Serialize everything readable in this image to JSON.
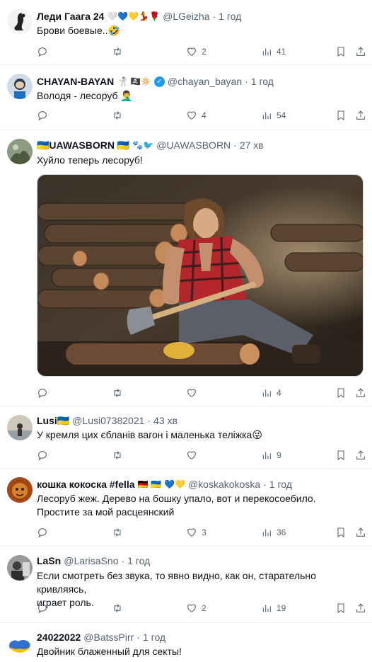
{
  "tweets": [
    {
      "name": "Леди Гаага 24",
      "name_emoji": "🤍💙💛💃🌹",
      "handle": "@LGeizha",
      "time": "1 год",
      "lines": [
        "Брови боевые..🤣"
      ],
      "likes": "2",
      "views": "41"
    },
    {
      "name": "CHAYAN-BAYAN",
      "name_emoji": "🤺 🏴‍☠️🔅",
      "handle": "@chayan_bayan",
      "time": "1 год",
      "lines": [
        "Володя - лесоруб 🤦‍♂️"
      ],
      "likes": "4",
      "views": "54"
    },
    {
      "name": "🇺🇦UAWASBORN 🇺🇦",
      "name_emoji": "🐾🐦",
      "handle": "@UAWASBORN",
      "time": "27 хв",
      "lines": [
        "Хуйло теперь лесоруб!"
      ],
      "likes": "",
      "views": "4"
    },
    {
      "name": "Lusi🇺🇦",
      "name_emoji": "",
      "handle": "@Lusi07382021",
      "time": "43 хв",
      "lines": [
        "У кремля цих єбланів вагон і маленька теліжка😜"
      ],
      "likes": "",
      "views": "9"
    },
    {
      "name": "кошка кокоска #fella",
      "name_emoji": "🇩🇪 🇺🇦 💙💛",
      "handle": "@koskakokoska",
      "time": "1 год",
      "lines": [
        "Лесоруб жеж. Дерево на бошку упало, вот и перекосоебило.",
        "Простите за мой расцеянский"
      ],
      "likes": "3",
      "views": "36"
    },
    {
      "name": "LaSn",
      "name_emoji": "",
      "handle": "@LarisaSno",
      "time": "1 год",
      "lines": [
        "Если смотреть без звука, то явно видно, как он, старательно кривляясь,",
        "играет роль."
      ],
      "likes": "2",
      "views": "19"
    },
    {
      "name": "24022022",
      "name_emoji": "",
      "handle": "@BatssPirr",
      "time": "1 год",
      "lines": [
        "Двойник блаженный для секты!"
      ],
      "likes": "",
      "views": ""
    }
  ],
  "colors": {
    "accent": "#1d9bf0",
    "muted": "#536471",
    "border": "#eff3f4"
  },
  "icons": {
    "reply": "reply-icon",
    "retweet": "retweet-icon",
    "like": "heart-icon",
    "views": "views-icon",
    "bookmark": "bookmark-icon",
    "share": "share-icon"
  }
}
